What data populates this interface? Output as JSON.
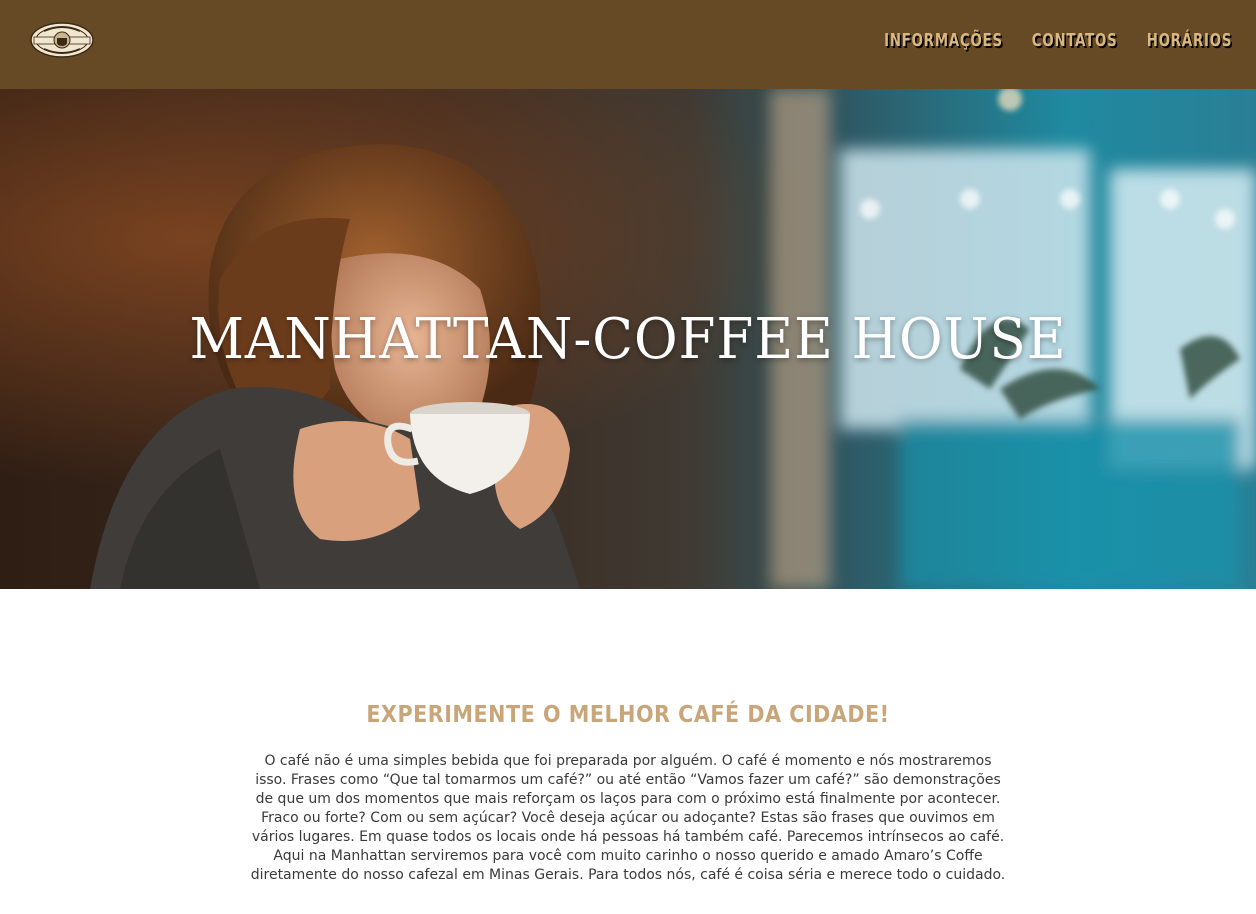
{
  "header": {
    "logo_icon": "manhattan-coffee-badge-icon",
    "nav": [
      {
        "label": "INFORMAÇÕES"
      },
      {
        "label": "CONTATOS"
      },
      {
        "label": "HORÁRIOS"
      }
    ]
  },
  "hero": {
    "title": "MANHATTAN-COFFEE HOUSE",
    "image_icon": "woman-drinking-coffee-photo"
  },
  "intro": {
    "heading": "EXPERIMENTE O MELHOR CAFÉ DA CIDADE!",
    "body": "O café não é uma simples bebida que foi preparada por alguém. O café é momento e nós mostraremos isso. Frases como “Que tal tomarmos um café?” ou até então “Vamos fazer um café?” são demonstrações de que um dos momentos que mais reforçam os laços para com o próximo está finalmente por acontecer. Fraco ou forte? Com ou sem açúcar? Você deseja açúcar ou adoçante? Estas são frases que ouvimos em vários lugares. Em quase todos os locais onde há pessoas há também café. Parecemos intrínsecos ao café. Aqui na Manhattan serviremos para você com muito carinho o nosso querido e amado Amaro’s Coffe diretamente do nosso cafezal em Minas Gerais. Para todos nós, café é coisa séria e merece todo o cuidado."
  },
  "colors": {
    "header_bg": "#654a25",
    "nav_text": "#d9b77e",
    "heading": "#c9a57a",
    "body_text": "#3a3a3a"
  }
}
